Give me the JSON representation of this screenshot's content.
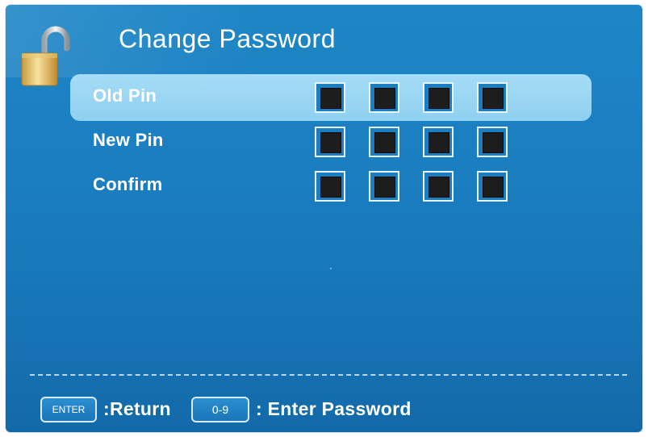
{
  "dialog": {
    "title": "Change Password",
    "icon": "padlock-open-icon",
    "accent_color": "#1a7ec0",
    "highlight_color": "#96d3f2"
  },
  "rows": [
    {
      "label": "Old Pin",
      "selected": true,
      "digits_entered": 4
    },
    {
      "label": "New Pin",
      "selected": false,
      "digits_entered": 4
    },
    {
      "label": "Confirm",
      "selected": false,
      "digits_entered": 4
    }
  ],
  "footer": {
    "enter_key": "ENTER",
    "enter_action": ":Return",
    "digits_key": "0-9",
    "digits_action": ": Enter Password"
  }
}
